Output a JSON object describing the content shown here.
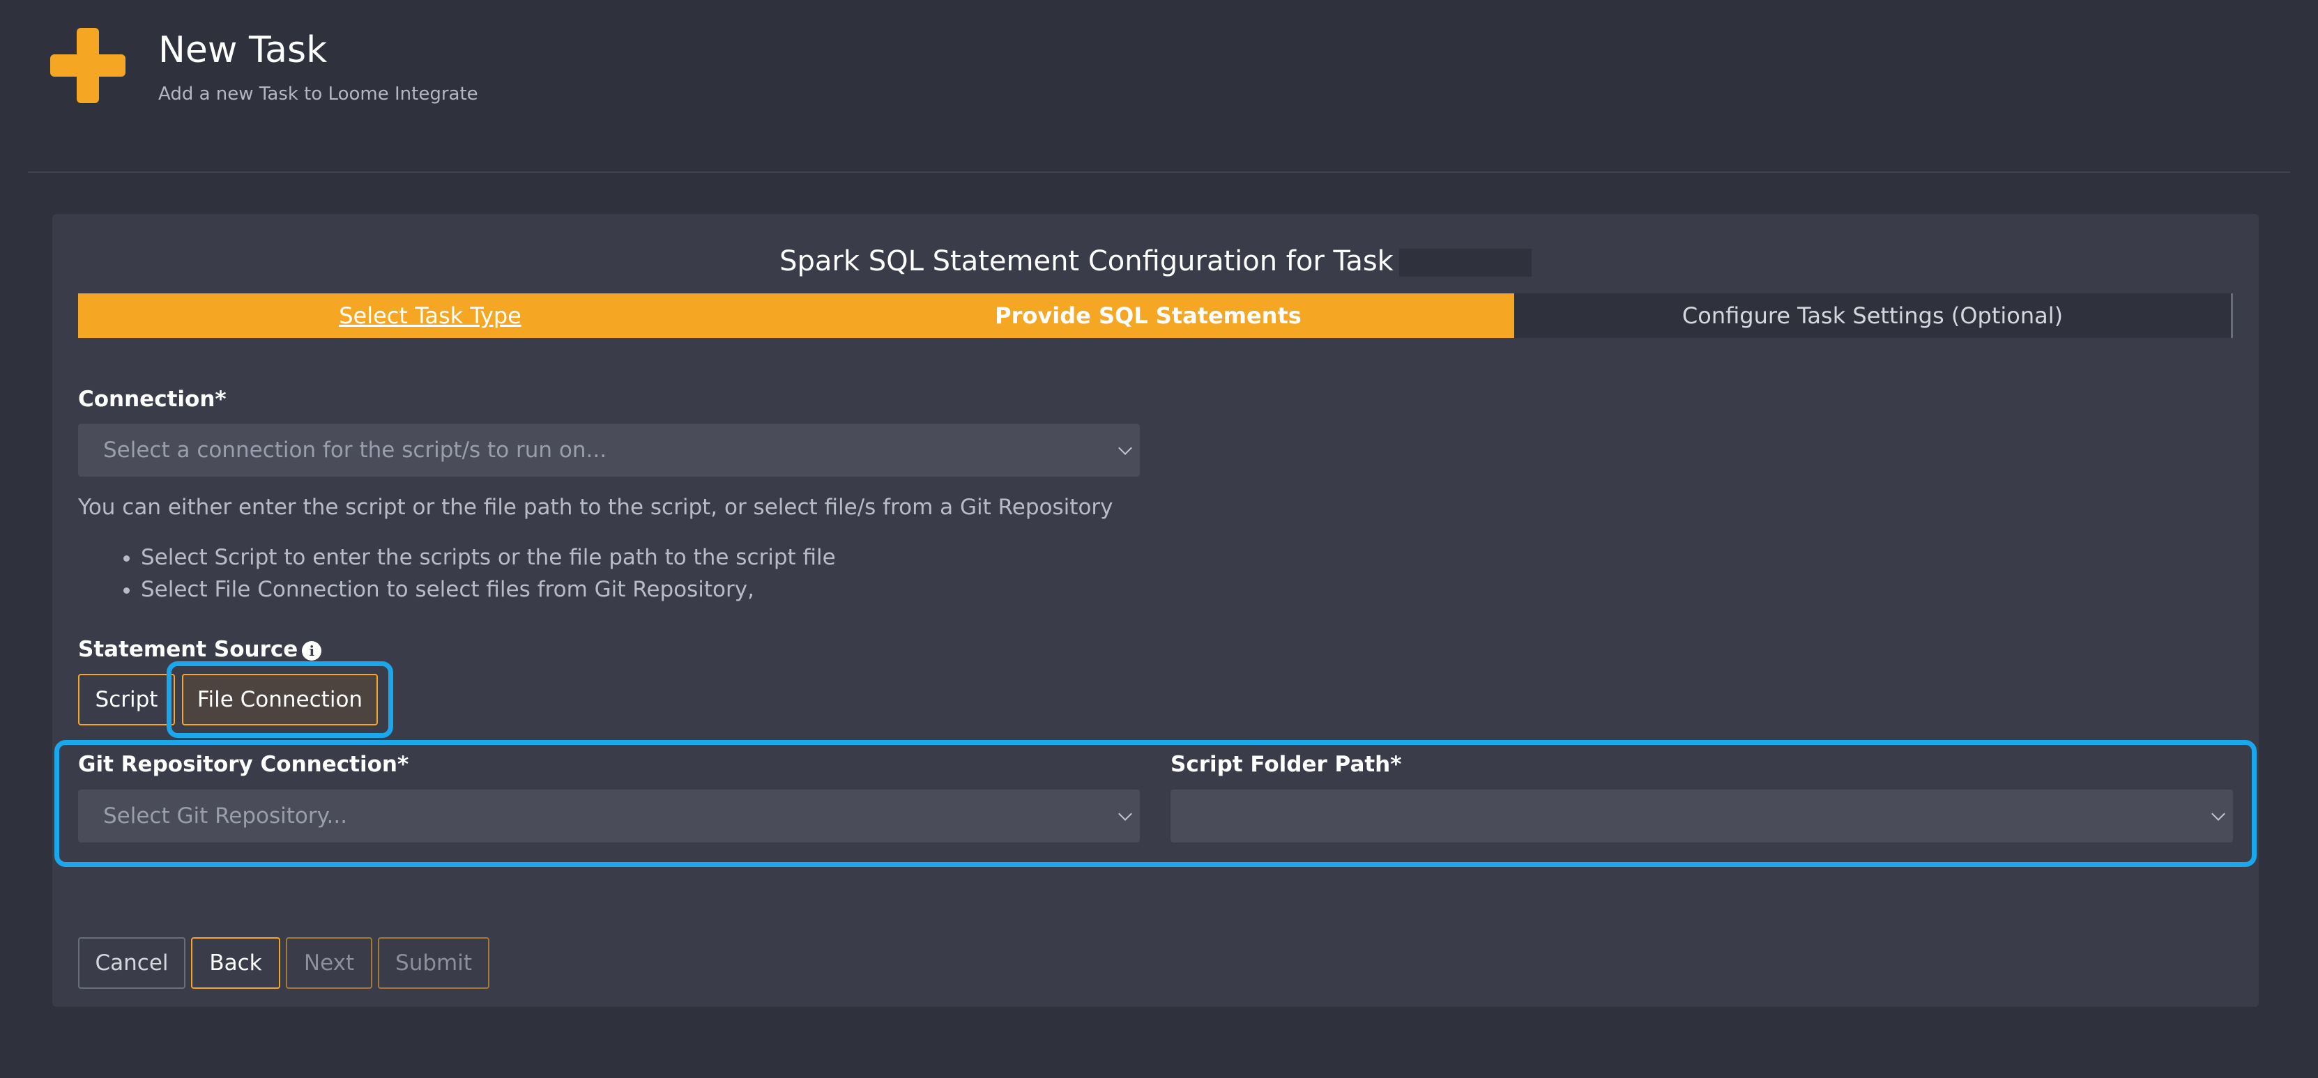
{
  "header": {
    "title": "New Task",
    "subtitle": "Add a new Task to Loome Integrate"
  },
  "card": {
    "title": "Spark SQL Statement Configuration for Task"
  },
  "stepper": {
    "steps": [
      {
        "label": "Select Task Type",
        "state": "completed"
      },
      {
        "label": "Provide SQL Statements",
        "state": "active"
      },
      {
        "label": "Configure Task Settings (Optional)",
        "state": "pending"
      }
    ]
  },
  "form": {
    "connection": {
      "label": "Connection*",
      "placeholder": "Select a connection for the script/s to run on..."
    },
    "help_text": "You can either enter the script or the file path to the script, or select file/s from a Git Repository",
    "bullets": [
      "Select Script to enter the scripts or the file path to the script file",
      "Select File Connection to select files from Git Repository,"
    ],
    "statement_source": {
      "label": "Statement Source",
      "options": [
        "Script",
        "File Connection"
      ],
      "selected": "File Connection"
    },
    "git_repository": {
      "label": "Git Repository Connection*",
      "placeholder": "Select Git Repository..."
    },
    "script_folder": {
      "label": "Script Folder Path*",
      "value": ""
    }
  },
  "actions": {
    "cancel": "Cancel",
    "back": "Back",
    "next": "Next",
    "submit": "Submit"
  },
  "colors": {
    "accent": "#f5a623",
    "highlight": "#1aa7ec",
    "background": "#2f323d",
    "card": "#3a3d49"
  }
}
